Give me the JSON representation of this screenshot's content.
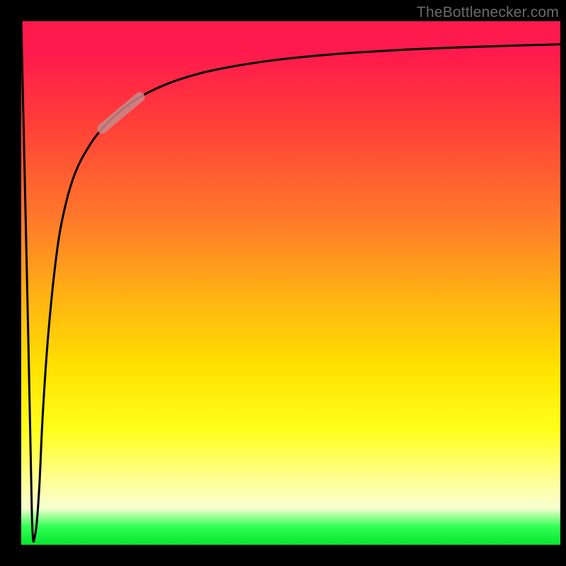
{
  "watermark": "TheBottlenecker.com",
  "chart_data": {
    "type": "line",
    "title": "",
    "xlabel": "",
    "ylabel": "",
    "xlim": [
      0,
      100
    ],
    "ylim": [
      0,
      100
    ],
    "series": [
      {
        "name": "curve",
        "x": [
          0,
          1.3,
          2.0,
          2.6,
          3.3,
          4.0,
          5.0,
          6.5,
          8.0,
          10.0,
          12.5,
          15.0,
          18.0,
          22.0,
          27.0,
          33.0,
          40.0,
          48.0,
          58.0,
          70.0,
          84.0,
          100.0
        ],
        "y": [
          100,
          40,
          5,
          2,
          10,
          25,
          40,
          55,
          64,
          71,
          76,
          79.5,
          82.5,
          85.5,
          88,
          90,
          91.5,
          92.7,
          93.7,
          94.5,
          95.1,
          95.6
        ]
      }
    ],
    "highlight_segment": {
      "x0": 15.0,
      "y0": 79.5,
      "x1": 22.0,
      "y1": 85.5
    },
    "colors": {
      "curve": "#000000",
      "highlight": "#c98a8a"
    }
  }
}
